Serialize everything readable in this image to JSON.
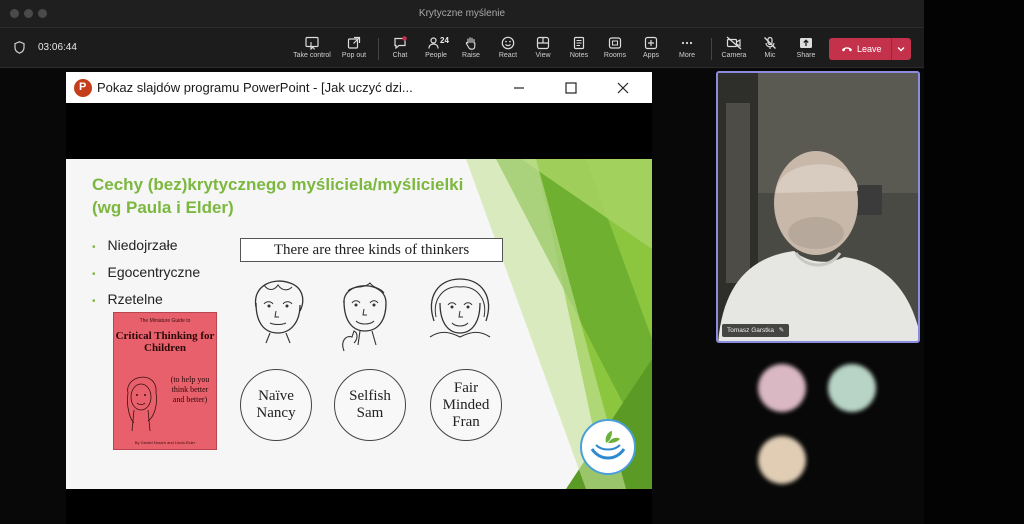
{
  "window": {
    "title": "Krytyczne myślenie"
  },
  "toolbar": {
    "timer": "03:06:44",
    "buttons": [
      {
        "key": "take_control",
        "label": "Take control",
        "icon": "take-control-icon"
      },
      {
        "key": "pop_out",
        "label": "Pop out",
        "icon": "pop-out-icon"
      },
      {
        "key": "chat",
        "label": "Chat",
        "icon": "chat-icon"
      },
      {
        "key": "people",
        "label": "People",
        "icon": "people-icon",
        "count": "24"
      },
      {
        "key": "raise",
        "label": "Raise",
        "icon": "hand-icon"
      },
      {
        "key": "react",
        "label": "React",
        "icon": "smile-icon"
      },
      {
        "key": "view",
        "label": "View",
        "icon": "view-icon"
      },
      {
        "key": "notes",
        "label": "Notes",
        "icon": "notes-icon"
      },
      {
        "key": "rooms",
        "label": "Rooms",
        "icon": "rooms-icon"
      },
      {
        "key": "apps",
        "label": "Apps",
        "icon": "apps-icon"
      },
      {
        "key": "more",
        "label": "More",
        "icon": "more-icon"
      },
      {
        "key": "camera",
        "label": "Camera",
        "icon": "camera-off-icon"
      },
      {
        "key": "mic",
        "label": "Mic",
        "icon": "mic-off-icon"
      },
      {
        "key": "share",
        "label": "Share",
        "icon": "share-icon"
      }
    ],
    "leave_label": "Leave",
    "leave_color": "#c4314b"
  },
  "ppt": {
    "title": "Pokaz slajdów programu PowerPoint - [Jak uczyć dzi...",
    "logo_letter": "P"
  },
  "slide": {
    "title_line1": "Cechy (bez)krytycznego myśliciela/myślicielki",
    "title_line2": "(wg Paula i Elder)",
    "bullets": [
      "Niedojrzałe",
      "Egocentryczne",
      "Rzetelne"
    ],
    "thinkers_caption": "There are three kinds of thinkers",
    "characters": [
      {
        "line1": "Naïve",
        "line2": "Nancy",
        "line3": ""
      },
      {
        "line1": "Selfish",
        "line2": "Sam",
        "line3": ""
      },
      {
        "line1": "Fair",
        "line2": "Minded",
        "line3": "Fran"
      }
    ],
    "book": {
      "series": "The Miniature Guide to",
      "title": "Critical Thinking for Children",
      "subtitle": "(to help you think better and better)",
      "authors": "By Gerald Nosich and Linda Elder"
    },
    "accent_color": "#7cb83f"
  },
  "participant": {
    "name": "Tomasz Garstka"
  }
}
